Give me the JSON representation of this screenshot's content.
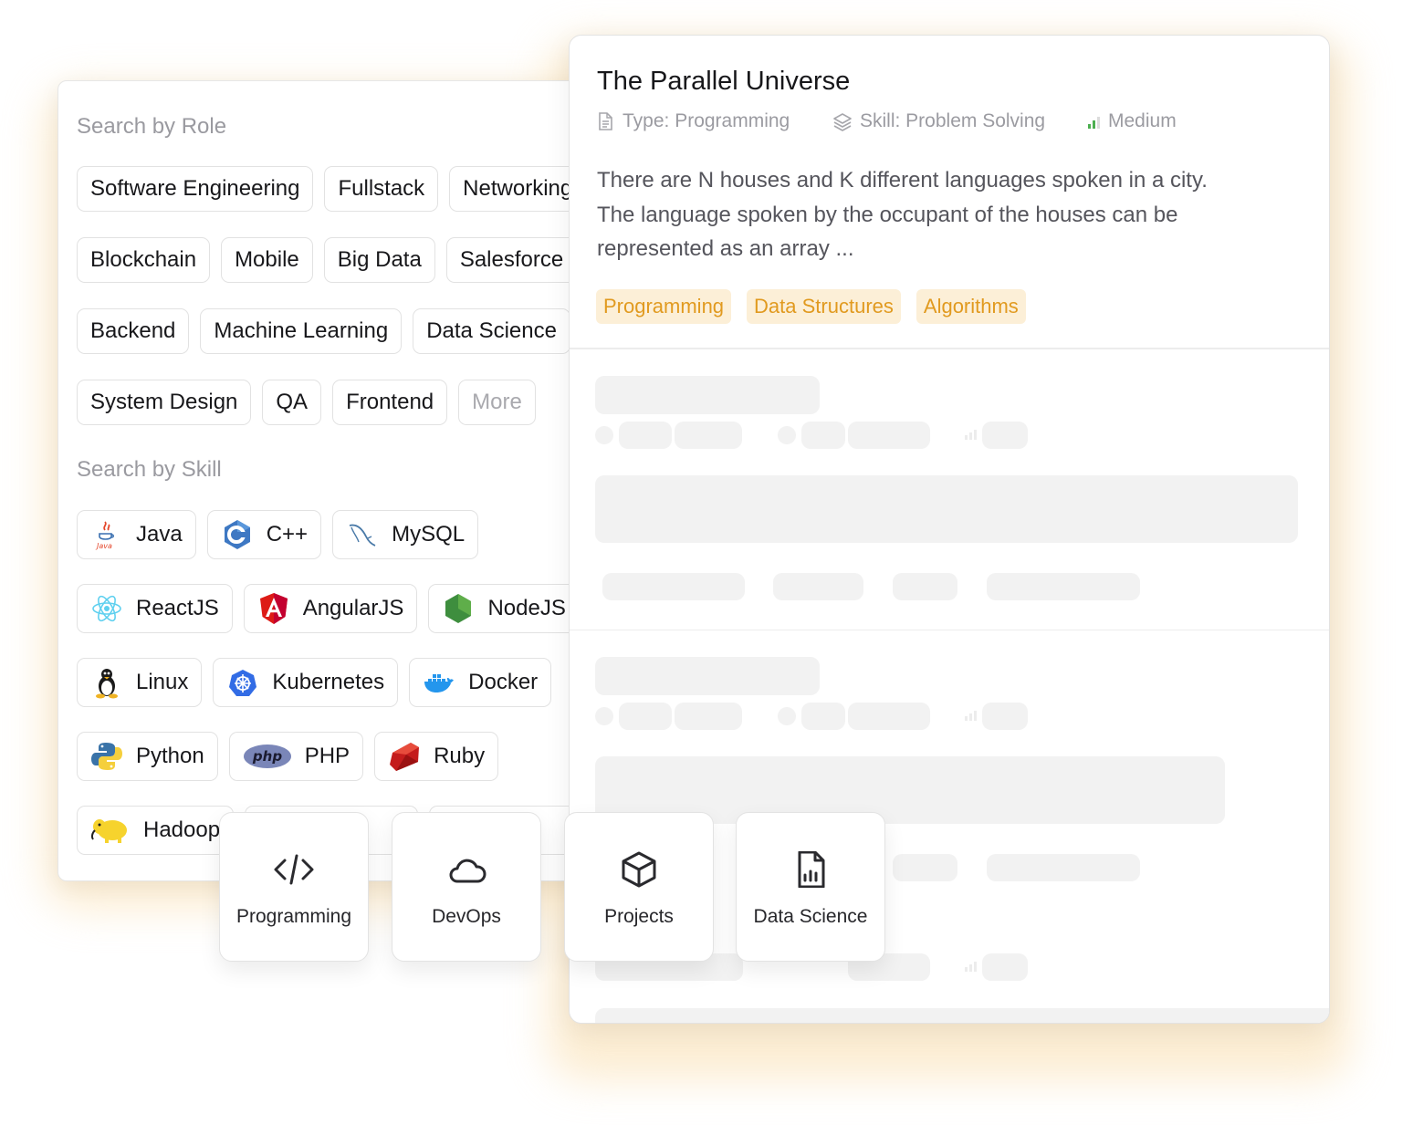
{
  "role_section": {
    "label": "Search by Role",
    "rows": [
      [
        "Software Engineering",
        "Fullstack",
        "Networking"
      ],
      [
        "Blockchain",
        "Mobile",
        "Big Data",
        "Salesforce"
      ],
      [
        "Backend",
        "Machine Learning",
        "Data Science"
      ],
      [
        "System Design",
        "QA",
        "Frontend"
      ]
    ],
    "more_label": "More"
  },
  "skill_section": {
    "label": "Search by Skill",
    "rows": [
      [
        {
          "label": "Java",
          "icon": "java-icon"
        },
        {
          "label": "C++",
          "icon": "cpp-icon"
        },
        {
          "label": "MySQL",
          "icon": "mysql-icon"
        }
      ],
      [
        {
          "label": "ReactJS",
          "icon": "react-icon"
        },
        {
          "label": "AngularJS",
          "icon": "angular-icon"
        },
        {
          "label": "NodeJS",
          "icon": "nodejs-icon"
        }
      ],
      [
        {
          "label": "Linux",
          "icon": "linux-icon"
        },
        {
          "label": "Kubernetes",
          "icon": "kubernetes-icon"
        },
        {
          "label": "Docker",
          "icon": "docker-icon"
        }
      ],
      [
        {
          "label": "Python",
          "icon": "python-icon"
        },
        {
          "label": "PHP",
          "icon": "php-icon"
        },
        {
          "label": "Ruby",
          "icon": "ruby-icon"
        }
      ],
      [
        {
          "label": "Hadoop",
          "icon": "hadoop-icon"
        }
      ]
    ],
    "php_logo_text": "php",
    "java_logo_text": "Java"
  },
  "question": {
    "title": "The Parallel Universe",
    "type_text": "Type: Programming",
    "skill_text": "Skill: Problem Solving",
    "difficulty_text": "Medium",
    "description_lines": [
      "There are N houses and K different languages spoken in a city.",
      "The language spoken by the occupant of the houses can be",
      "represented as an array ..."
    ],
    "tags": [
      "Programming",
      "Data Structures",
      "Algorithms"
    ]
  },
  "categories": [
    {
      "label": "Programming",
      "icon": "code-icon"
    },
    {
      "label": "DevOps",
      "icon": "cloud-icon"
    },
    {
      "label": "Projects",
      "icon": "box-icon"
    },
    {
      "label": "Data Science",
      "icon": "chart-file-icon"
    }
  ],
  "colors": {
    "tag_bg": "#fcefd7",
    "tag_text": "#e19a1f",
    "glow": "#fbe7c4",
    "muted_text": "#9b9ba1",
    "skeleton": "#f2f2f2"
  }
}
